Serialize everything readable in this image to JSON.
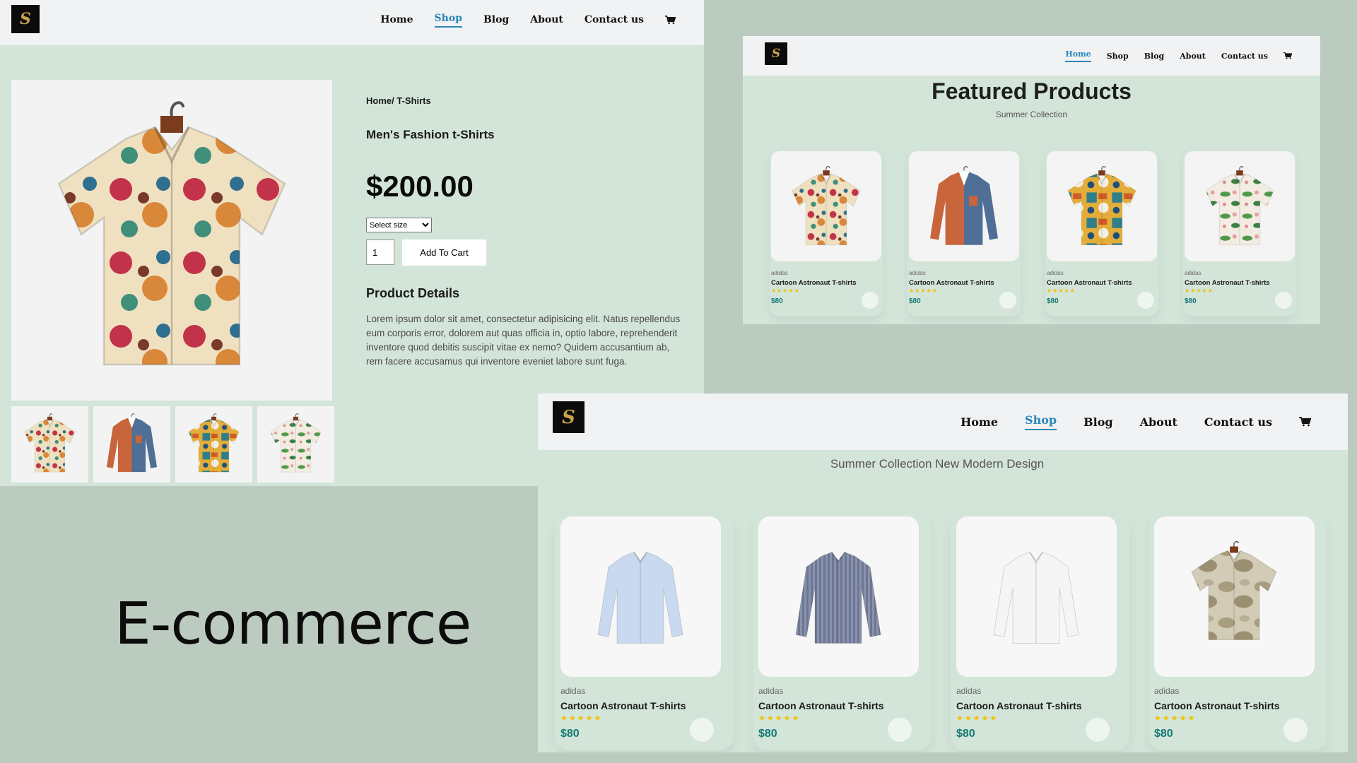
{
  "colors": {
    "background": "#bccbc0",
    "panel": "#d3e4d8",
    "nav": "#f0f2f4",
    "active_link": "#2a86b8",
    "price_teal": "#137a73",
    "star": "#f2c200",
    "logo_bg": "#0b0b0b",
    "logo_gold": "#c9a24a"
  },
  "logo": {
    "letter": "S"
  },
  "nav": {
    "items": [
      "Home",
      "Shop",
      "Blog",
      "About",
      "Contact us"
    ],
    "cart_icon": "shopping-cart-icon"
  },
  "product": {
    "breadcrumb": "Home/ T-Shirts",
    "title": "Men's Fashion t-Shirts",
    "price": "$200.00",
    "size_select": "Select size",
    "qty": "1",
    "add_to_cart": "Add To Cart",
    "details_title": "Product Details",
    "description": "Lorem ipsum dolor sit amet, consectetur adipisicing elit. Natus repellendus eum corporis error, dolorem aut quas officia in, optio labore, reprehenderit inventore quod debitis suscipit vitae ex nemo? Quidem accusantium ab, rem facere accusamus qui inventore eveniet labore sunt fuga."
  },
  "featured": {
    "title": "Featured Products",
    "subtitle": "Summer Collection",
    "cards": [
      {
        "brand": "adidas",
        "name": "Cartoon Astronaut T-shirts",
        "price": "$80",
        "rating": 5
      },
      {
        "brand": "adidas",
        "name": "Cartoon Astronaut T-shirts",
        "price": "$80",
        "rating": 5
      },
      {
        "brand": "adidas",
        "name": "Cartoon Astronaut T-shirts",
        "price": "$80",
        "rating": 5
      },
      {
        "brand": "adidas",
        "name": "Cartoon Astronaut T-shirts",
        "price": "$80",
        "rating": 5
      }
    ]
  },
  "shop": {
    "subtitle": "Summer Collection New Modern Design",
    "cards": [
      {
        "brand": "adidas",
        "name": "Cartoon Astronaut T-shirts",
        "price": "$80",
        "rating": 5
      },
      {
        "brand": "adidas",
        "name": "Cartoon Astronaut T-shirts",
        "price": "$80",
        "rating": 5
      },
      {
        "brand": "adidas",
        "name": "Cartoon Astronaut T-shirts",
        "price": "$80",
        "rating": 5
      },
      {
        "brand": "adidas",
        "name": "Cartoon Astronaut T-shirts",
        "price": "$80",
        "rating": 5
      }
    ]
  },
  "big_title": "E-commerce"
}
